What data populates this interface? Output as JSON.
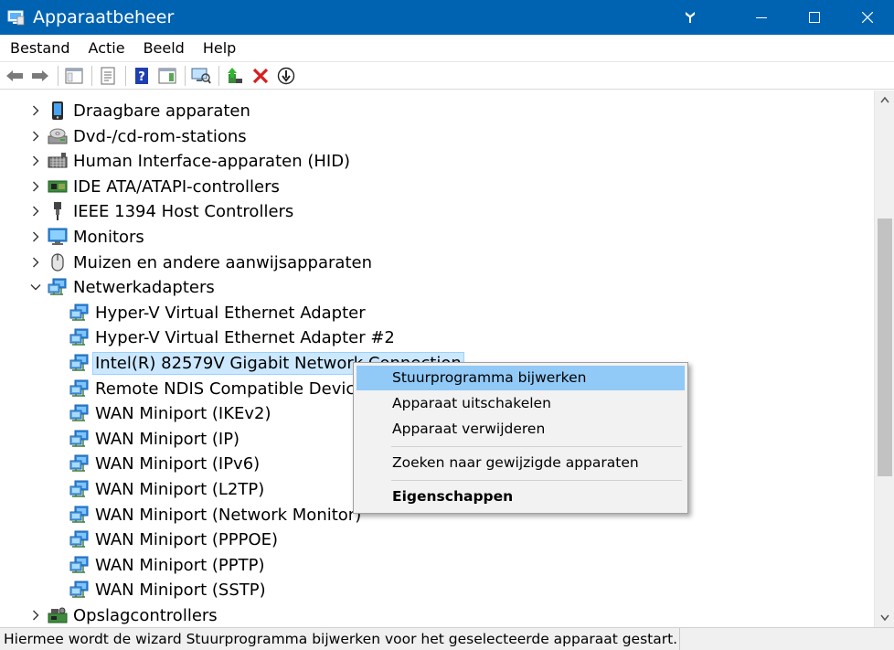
{
  "window": {
    "title": "Apparaatbeheer",
    "app_icon": "device-manager-icon"
  },
  "menu": [
    "Bestand",
    "Actie",
    "Beeld",
    "Help"
  ],
  "toolbar": [
    "back",
    "forward",
    "show-hide-console-tree",
    "properties",
    "help",
    "action-pane",
    "scan-hardware",
    "update-driver",
    "uninstall-device",
    "disable-device"
  ],
  "tree": [
    {
      "label": "Draagbare apparaten",
      "icon": "portable-device-icon",
      "level": 0,
      "expander": "collapsed"
    },
    {
      "label": "Dvd-/cd-rom-stations",
      "icon": "dvd-drive-icon",
      "level": 0,
      "expander": "collapsed"
    },
    {
      "label": "Human Interface-apparaten (HID)",
      "icon": "hid-icon",
      "level": 0,
      "expander": "collapsed"
    },
    {
      "label": "IDE ATA/ATAPI-controllers",
      "icon": "ide-controller-icon",
      "level": 0,
      "expander": "collapsed"
    },
    {
      "label": "IEEE 1394 Host Controllers",
      "icon": "ieee1394-icon",
      "level": 0,
      "expander": "collapsed"
    },
    {
      "label": "Monitors",
      "icon": "monitor-icon",
      "level": 0,
      "expander": "collapsed"
    },
    {
      "label": "Muizen en andere aanwijsapparaten",
      "icon": "mouse-icon",
      "level": 0,
      "expander": "collapsed"
    },
    {
      "label": "Netwerkadapters",
      "icon": "network-adapter-icon",
      "level": 0,
      "expander": "expanded"
    },
    {
      "label": "Hyper-V Virtual Ethernet Adapter",
      "icon": "network-adapter-icon",
      "level": 1
    },
    {
      "label": "Hyper-V Virtual Ethernet Adapter #2",
      "icon": "network-adapter-icon",
      "level": 1
    },
    {
      "label": "Intel(R) 82579V Gigabit Network Connection",
      "icon": "network-adapter-icon",
      "level": 1,
      "selected": true
    },
    {
      "label": "Remote NDIS Compatible Device",
      "icon": "network-adapter-icon",
      "level": 1
    },
    {
      "label": "WAN Miniport (IKEv2)",
      "icon": "network-adapter-icon",
      "level": 1
    },
    {
      "label": "WAN Miniport (IP)",
      "icon": "network-adapter-icon",
      "level": 1
    },
    {
      "label": "WAN Miniport (IPv6)",
      "icon": "network-adapter-icon",
      "level": 1
    },
    {
      "label": "WAN Miniport (L2TP)",
      "icon": "network-adapter-icon",
      "level": 1
    },
    {
      "label": "WAN Miniport (Network Monitor)",
      "icon": "network-adapter-icon",
      "level": 1
    },
    {
      "label": "WAN Miniport (PPPOE)",
      "icon": "network-adapter-icon",
      "level": 1
    },
    {
      "label": "WAN Miniport (PPTP)",
      "icon": "network-adapter-icon",
      "level": 1
    },
    {
      "label": "WAN Miniport (SSTP)",
      "icon": "network-adapter-icon",
      "level": 1
    },
    {
      "label": "Opslagcontrollers",
      "icon": "storage-controller-icon",
      "level": 0,
      "expander": "collapsed"
    }
  ],
  "context_menu": [
    {
      "label": "Stuurprogramma bijwerken",
      "highlighted": true
    },
    {
      "label": "Apparaat uitschakelen"
    },
    {
      "label": "Apparaat verwijderen"
    },
    {
      "separator": true
    },
    {
      "label": "Zoeken naar gewijzigde apparaten"
    },
    {
      "separator": true
    },
    {
      "label": "Eigenschappen",
      "bold": true
    }
  ],
  "status": "Hiermee wordt de wizard Stuurprogramma bijwerken voor het geselecteerde apparaat gestart.",
  "colors": {
    "titlebar": "#0063b1",
    "selection": "#cce8ff",
    "menu_highlight": "#91c9f7"
  }
}
